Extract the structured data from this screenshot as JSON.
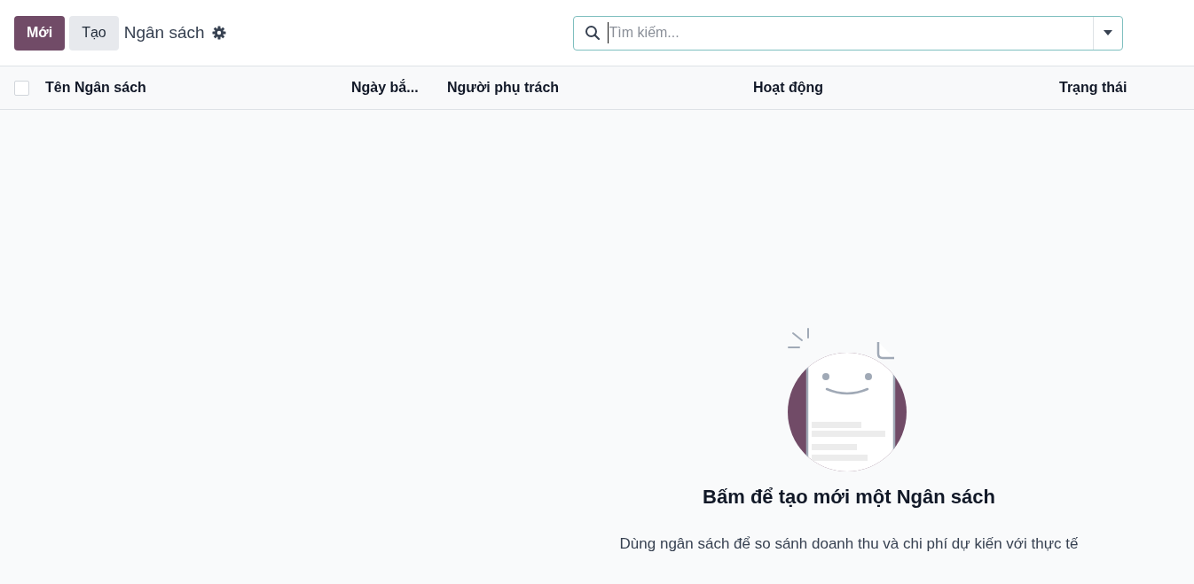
{
  "control_panel": {
    "buttons": [
      {
        "label": "Mới",
        "kind": "primary"
      },
      {
        "label": "Tạo",
        "kind": "secondary"
      }
    ],
    "title": "Ngân sách",
    "search": {
      "placeholder": "Tìm kiếm..."
    }
  },
  "table": {
    "select_all": {
      "checked": false
    },
    "columns": [
      "Tên Ngân sách",
      "Ngày bắ...",
      "Người phụ trách",
      "Hoạt động",
      "Trạng thái"
    ]
  },
  "empty_state": {
    "title": "Bấm để tạo mới một Ngân sách",
    "description": "Dùng ngân sách để so sánh doanh thu và chi phí dự kiến với thực tế"
  }
}
